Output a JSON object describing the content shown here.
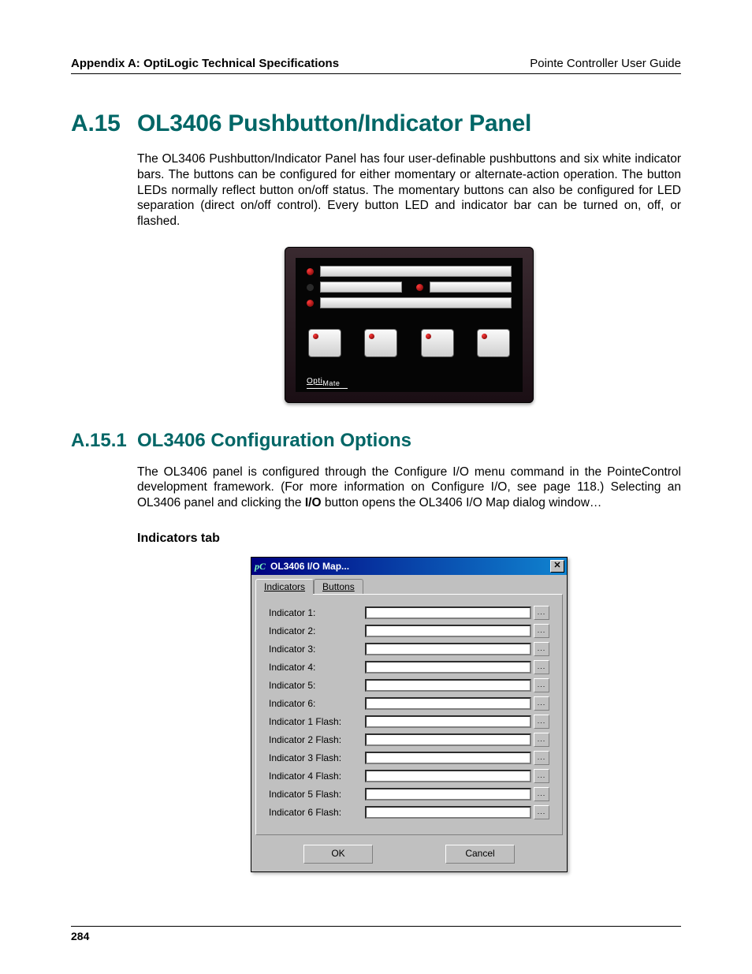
{
  "header": {
    "left": "Appendix A: OptiLogic Technical Specifications",
    "right": "Pointe Controller User Guide"
  },
  "section": {
    "num": "A.15",
    "title": "OL3406 Pushbutton/Indicator Panel",
    "para1": "The OL3406 Pushbutton/Indicator Panel has four user-definable pushbuttons and six white indicator bars. The buttons can be configured for either momentary or alternate-action operation. The button LEDs normally reflect button on/off status. The momentary buttons can also be configured for LED separation (direct on/off control). Every button LED and indicator bar can be turned on, off, or flashed."
  },
  "device": {
    "brand": "Opti",
    "brand_suffix": "Mate"
  },
  "subsection": {
    "num": "A.15.1",
    "title": "OL3406 Configuration Options",
    "para_a": "The OL3406 panel is configured through the Configure I/O menu command in the PointeControl development framework. (For more information on Configure I/O, see page 118.) Selecting an OL3406 panel and clicking the ",
    "bold": "I/O",
    "para_b": " button opens the OL3406 I/O Map dialog window…",
    "smallhead": "Indicators tab"
  },
  "dialog": {
    "title": "OL3406 I/O Map...",
    "logo": "pC",
    "tabs": {
      "indicators": "Indicators",
      "buttons": "Buttons"
    },
    "active_tab": "indicators",
    "fields": [
      "Indicator 1:",
      "Indicator 2:",
      "Indicator 3:",
      "Indicator 4:",
      "Indicator 5:",
      "Indicator 6:",
      "Indicator 1 Flash:",
      "Indicator 2 Flash:",
      "Indicator 3 Flash:",
      "Indicator 4 Flash:",
      "Indicator 5 Flash:",
      "Indicator 6 Flash:"
    ],
    "picker_label": "...",
    "ok": "OK",
    "cancel": "Cancel"
  },
  "footer": {
    "page": "284"
  }
}
